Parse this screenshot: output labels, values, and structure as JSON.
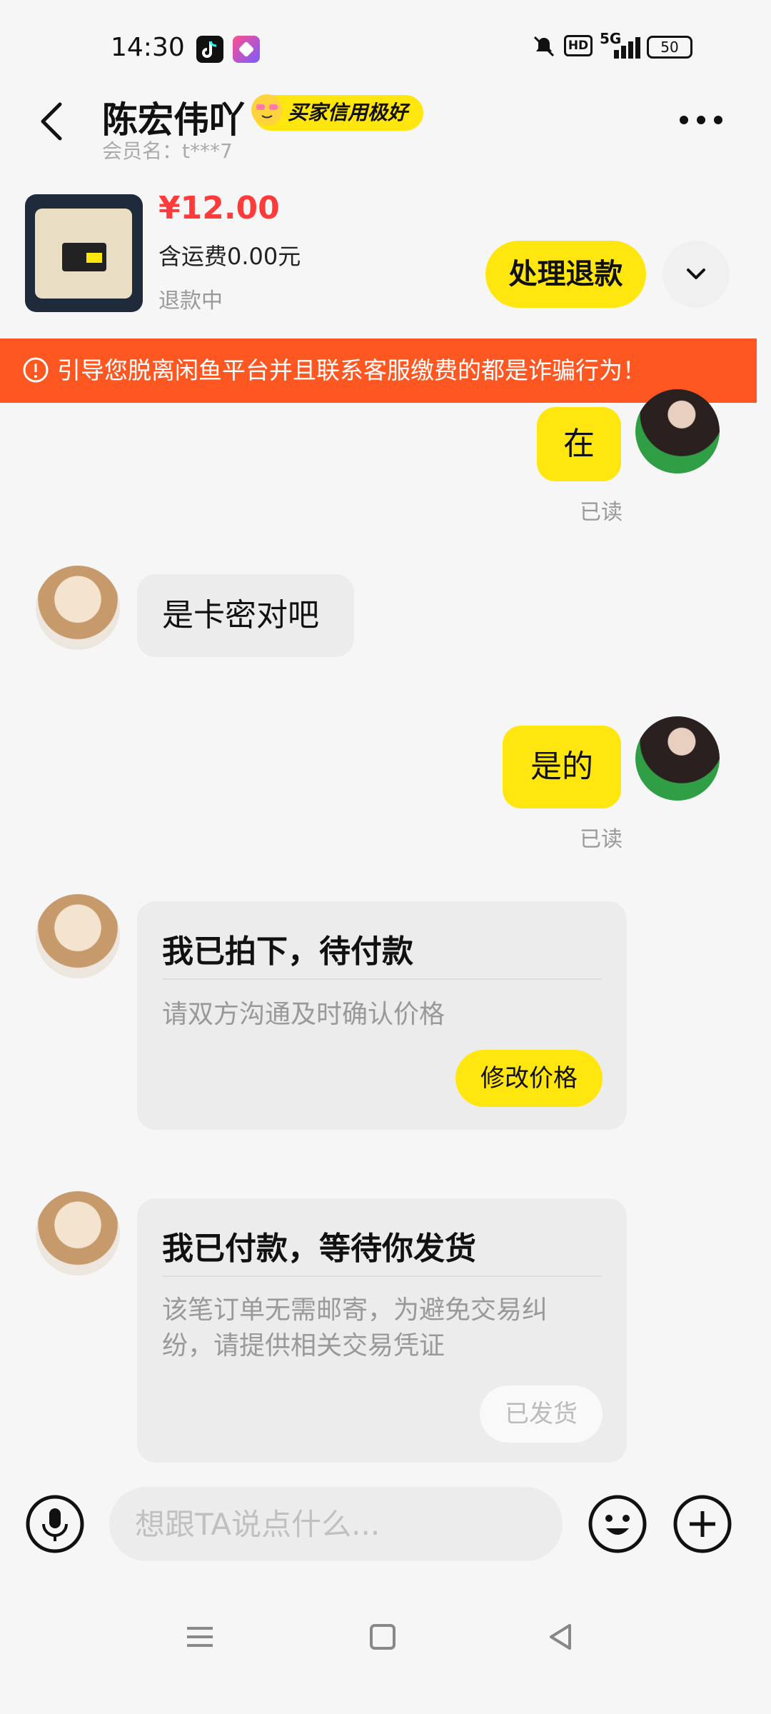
{
  "status_bar": {
    "time": "14:30",
    "hd": "HD",
    "network": "5G",
    "battery": "50",
    "icons": [
      "tiktok-icon",
      "app-icon",
      "mute-icon",
      "signal-icon",
      "battery-icon"
    ]
  },
  "header": {
    "name": "陈宏伟吖",
    "badge": "买家信用极好",
    "member": "会员名：t***7"
  },
  "product": {
    "price": "¥12.00",
    "shipping": "含运费0.00元",
    "status": "退款中",
    "refund_button": "处理退款"
  },
  "warning": "引导您脱离闲鱼平台并且联系客服缴费的都是诈骗行为！",
  "messages": {
    "m1": {
      "text": "在",
      "read": "已读"
    },
    "m2": {
      "text": "是卡密对吧"
    },
    "m3": {
      "text": "是的",
      "read": "已读"
    },
    "card1": {
      "title": "我已拍下，待付款",
      "desc": "请双方沟通及时确认价格",
      "button": "修改价格"
    },
    "card2": {
      "title": "我已付款，等待你发货",
      "desc": "该笔订单无需邮寄，为避免交易纠纷，请提供相关交易凭证",
      "button": "已发货"
    }
  },
  "input": {
    "placeholder": "想跟TA说点什么..."
  },
  "colors": {
    "accent": "#ffe60f",
    "price": "#ff3b3b",
    "warning_bg": "#ff5722"
  }
}
